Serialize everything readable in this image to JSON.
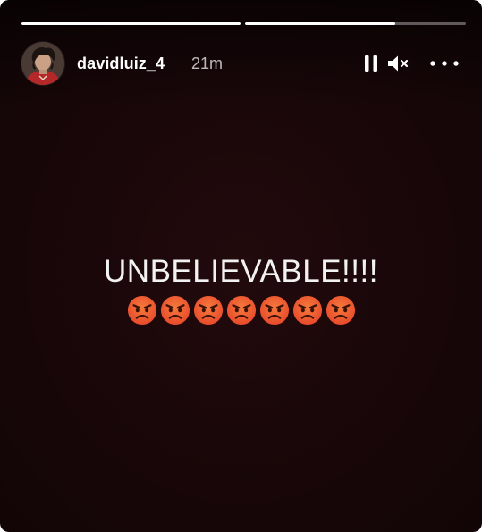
{
  "story": {
    "progress": [
      {
        "fill": 1.0
      },
      {
        "fill": 0.68
      }
    ],
    "user": {
      "username": "davidluiz_4",
      "time_ago": "21m"
    },
    "controls": {
      "pause_icon": "pause-icon",
      "mute_icon": "speaker-muted-icon",
      "more_icon": "more-options-icon"
    },
    "text": {
      "headline": "UNBELIEVABLE!!!!",
      "emoji": "😡",
      "emoji_count": 7
    },
    "colors": {
      "background": "#1a0709",
      "text": "#f2f2f2",
      "emoji_face": "#e84a2b"
    }
  }
}
